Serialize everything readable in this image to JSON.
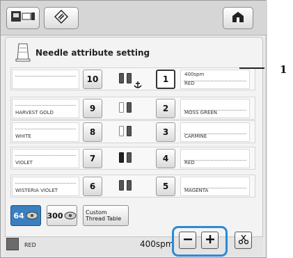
{
  "panel": {
    "title": "Needle attribute setting"
  },
  "left_rows": [
    {
      "label": "",
      "needle": "10"
    },
    {
      "label": "HARVEST GOLD",
      "needle": "9"
    },
    {
      "label": "WHITE",
      "needle": "8"
    },
    {
      "label": "VIOLET",
      "needle": "7"
    },
    {
      "label": "WISTERIA VIOLET",
      "needle": "6"
    }
  ],
  "right_rows": [
    {
      "needle": "1",
      "speed": "400spm",
      "label": "RED",
      "selected": true
    },
    {
      "needle": "2",
      "speed": "",
      "label": "MOSS GREEN"
    },
    {
      "needle": "3",
      "speed": "",
      "label": "CARMINE"
    },
    {
      "needle": "4",
      "speed": "",
      "label": "RED"
    },
    {
      "needle": "5",
      "speed": "",
      "label": "MAGENTA"
    }
  ],
  "thread_buttons": {
    "b64": "64",
    "b300": "300",
    "custom": "Custom Thread Table"
  },
  "footer": {
    "color_name": "RED",
    "speed": "400spm"
  },
  "callout": {
    "number": "1"
  },
  "icons": [
    "embroidery-machine-icon",
    "needle-mode-icon",
    "home-icon",
    "anchor-icon",
    "thread-cone-icon",
    "scissors-icon",
    "minus-icon",
    "plus-icon"
  ],
  "colors": {
    "accent": "#2a8bd6",
    "background": "#e9e9e9"
  }
}
